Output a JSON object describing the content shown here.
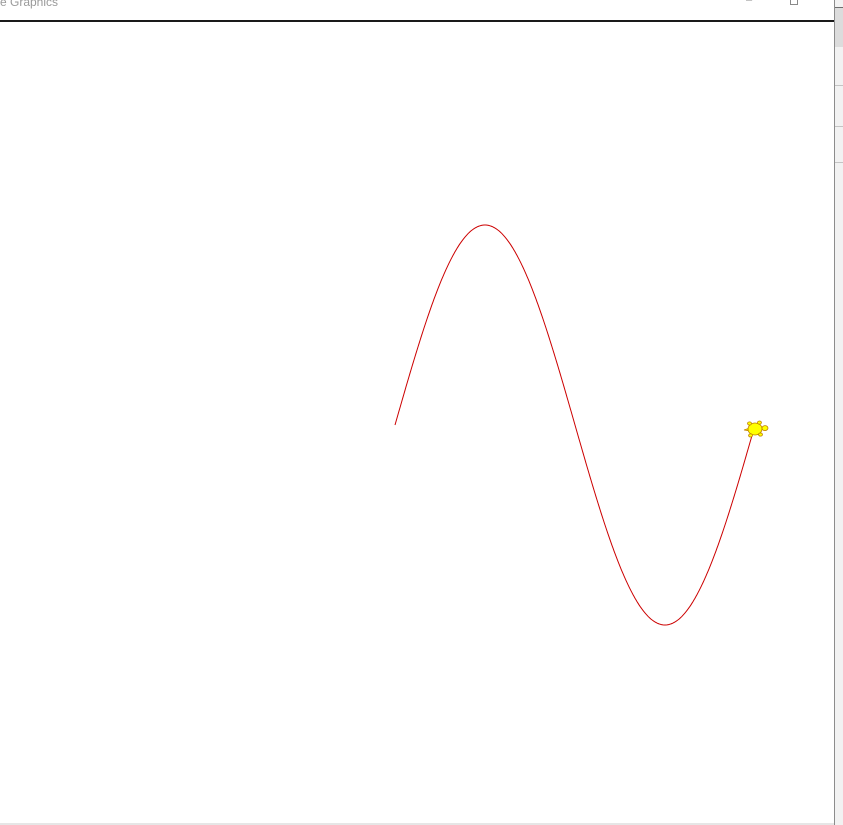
{
  "window": {
    "title": "tle Graphics",
    "minimize_glyph": "–",
    "pen_color": "#cc0000",
    "turtle_fill": "#ffff00",
    "turtle_outline": "#c08000",
    "turtle_icon": "turtle-icon"
  }
}
